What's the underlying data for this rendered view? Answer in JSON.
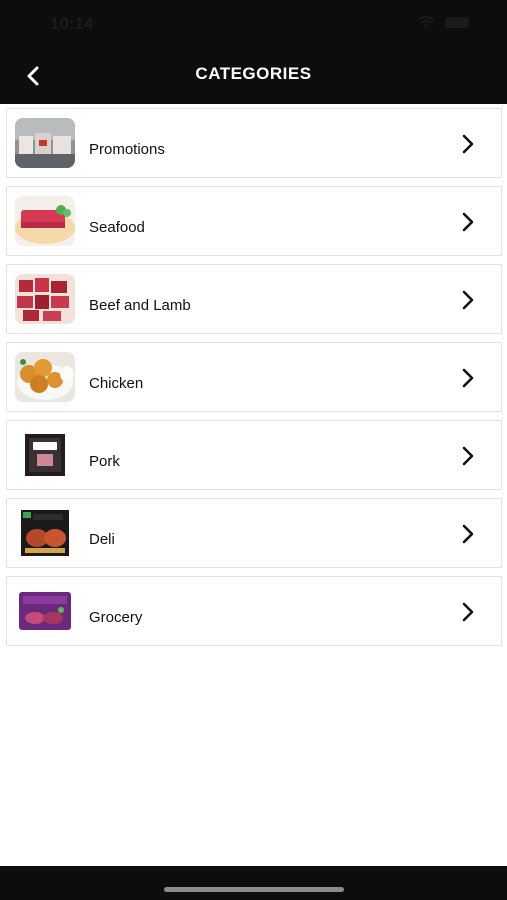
{
  "status_bar": {
    "time": "10:14",
    "wifi_icon": "wifi-icon",
    "battery_icon": "battery-icon"
  },
  "header": {
    "title": "CATEGORIES",
    "back_icon": "chevron-left-icon"
  },
  "categories": [
    {
      "label": "Promotions"
    },
    {
      "label": "Seafood"
    },
    {
      "label": "Beef and Lamb"
    },
    {
      "label": "Chicken"
    },
    {
      "label": "Pork"
    },
    {
      "label": "Deli"
    },
    {
      "label": "Grocery"
    }
  ],
  "row_chevron_icon": "chevron-right-icon",
  "colors": {
    "header_bg": "#0d0d0d",
    "text": "#111111",
    "row_border": "#e3e3e3"
  }
}
